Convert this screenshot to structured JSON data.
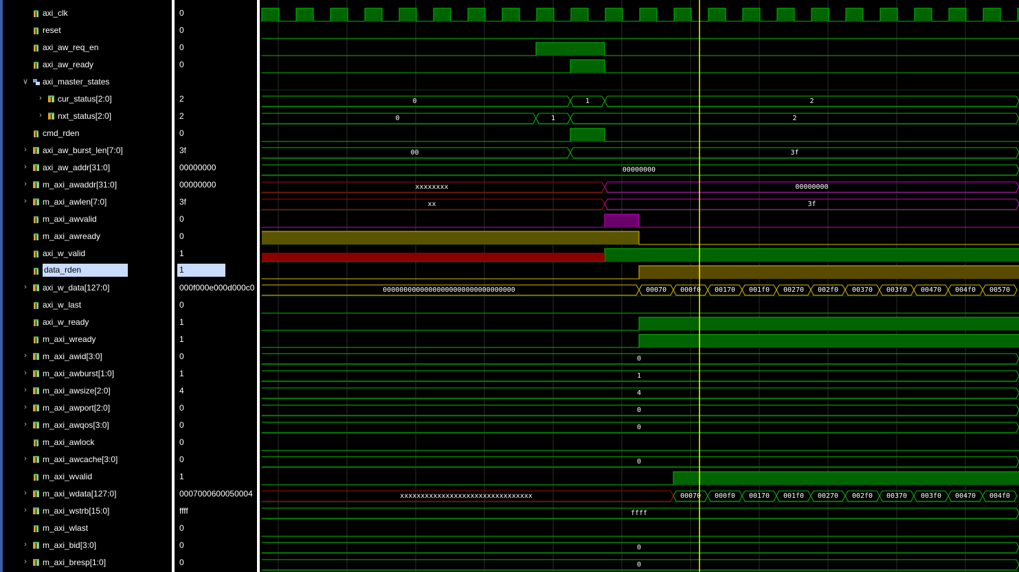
{
  "colors": {
    "background": "#000000",
    "grid": "#2c2c2c",
    "signal_line": "#00c000",
    "signal_fill": "#006400",
    "selected_row": "#c9dcff",
    "cursor": "#ffff00",
    "undefined": "#c00000",
    "purple": "#d000d0",
    "yellow_bus": "#d8c000"
  },
  "cursor": {
    "label": "time cursor"
  },
  "signals": [
    {
      "name": "axi_clk",
      "value": "0",
      "kind": "clock",
      "icon": "bit-signal-icon",
      "expand": false
    },
    {
      "name": "reset",
      "value": "0",
      "kind": "bit",
      "icon": "bit-signal-icon",
      "expand": false
    },
    {
      "name": "axi_aw_req_en",
      "value": "0",
      "kind": "bit",
      "icon": "bit-signal-icon",
      "expand": false
    },
    {
      "name": "axi_aw_ready",
      "value": "0",
      "kind": "bit",
      "icon": "bit-signal-icon",
      "expand": false
    },
    {
      "name": "axi_master_states",
      "value": "",
      "kind": "group",
      "icon": "group-icon",
      "expand": "open"
    },
    {
      "name": "cur_status[2:0]",
      "value": "2",
      "kind": "bus",
      "icon": "bus-signal-icon",
      "expand": "closed",
      "indent": 1
    },
    {
      "name": "nxt_status[2:0]",
      "value": "2",
      "kind": "bus",
      "icon": "bus-signal-icon",
      "expand": "closed",
      "indent": 1
    },
    {
      "name": "cmd_rden",
      "value": "0",
      "kind": "bit",
      "icon": "bit-signal-icon",
      "expand": false
    },
    {
      "name": "axi_aw_burst_len[7:0]",
      "value": "3f",
      "kind": "bus",
      "icon": "bus-signal-icon",
      "expand": "closed"
    },
    {
      "name": "axi_aw_addr[31:0]",
      "value": "00000000",
      "kind": "bus",
      "icon": "bus-signal-icon",
      "expand": "closed"
    },
    {
      "name": "m_axi_awaddr[31:0]",
      "value": "00000000",
      "kind": "bus",
      "icon": "bus-signal-icon",
      "expand": "closed"
    },
    {
      "name": "m_axi_awlen[7:0]",
      "value": "3f",
      "kind": "bus",
      "icon": "bus-signal-icon",
      "expand": "closed"
    },
    {
      "name": "m_axi_awvalid",
      "value": "0",
      "kind": "bit",
      "icon": "bit-signal-icon",
      "expand": false
    },
    {
      "name": "m_axi_awready",
      "value": "0",
      "kind": "bit",
      "icon": "bit-signal-icon",
      "expand": false
    },
    {
      "name": "axi_w_valid",
      "value": "1",
      "kind": "bit",
      "icon": "bit-signal-icon",
      "expand": false
    },
    {
      "name": "data_rden",
      "value": "1",
      "kind": "bit",
      "icon": "bit-signal-icon",
      "expand": false,
      "selected": true
    },
    {
      "name": "axi_w_data[127:0]",
      "value": "000f000e000d000c0",
      "kind": "bus",
      "icon": "bus-signal-icon",
      "expand": "closed"
    },
    {
      "name": "axi_w_last",
      "value": "0",
      "kind": "bit",
      "icon": "bit-signal-icon",
      "expand": false
    },
    {
      "name": "axi_w_ready",
      "value": "1",
      "kind": "bit",
      "icon": "bit-signal-icon",
      "expand": false
    },
    {
      "name": "m_axi_wready",
      "value": "1",
      "kind": "bit",
      "icon": "bit-signal-icon",
      "expand": false
    },
    {
      "name": "m_axi_awid[3:0]",
      "value": "0",
      "kind": "bus",
      "icon": "bus-signal-icon",
      "expand": "closed"
    },
    {
      "name": "m_axi_awburst[1:0]",
      "value": "1",
      "kind": "bus",
      "icon": "bus-signal-icon",
      "expand": "closed"
    },
    {
      "name": "m_axi_awsize[2:0]",
      "value": "4",
      "kind": "bus",
      "icon": "bus-signal-icon",
      "expand": "closed"
    },
    {
      "name": "m_axi_awport[2:0]",
      "value": "0",
      "kind": "bus",
      "icon": "bus-signal-icon",
      "expand": "closed"
    },
    {
      "name": "m_axi_awqos[3:0]",
      "value": "0",
      "kind": "bus",
      "icon": "bus-signal-icon",
      "expand": "closed"
    },
    {
      "name": "m_axi_awlock",
      "value": "0",
      "kind": "bit",
      "icon": "bit-signal-icon",
      "expand": false
    },
    {
      "name": "m_axi_awcache[3:0]",
      "value": "0",
      "kind": "bus",
      "icon": "bus-signal-icon",
      "expand": "closed"
    },
    {
      "name": "m_axi_wvalid",
      "value": "1",
      "kind": "bit",
      "icon": "bit-signal-icon",
      "expand": false
    },
    {
      "name": "m_axi_wdata[127:0]",
      "value": "0007000600050004",
      "kind": "bus",
      "icon": "bus-signal-icon",
      "expand": "closed"
    },
    {
      "name": "m_axi_wstrb[15:0]",
      "value": "ffff",
      "kind": "bus",
      "icon": "bus-signal-icon",
      "expand": "closed"
    },
    {
      "name": "m_axi_wlast",
      "value": "0",
      "kind": "bit",
      "icon": "bit-signal-icon",
      "expand": false
    },
    {
      "name": "m_axi_bid[3:0]",
      "value": "0",
      "kind": "bus",
      "icon": "bus-signal-icon",
      "expand": "closed"
    },
    {
      "name": "m_axi_bresp[1:0]",
      "value": "0",
      "kind": "bus",
      "icon": "bus-signal-icon",
      "expand": "closed"
    }
  ],
  "waves": {
    "cur_status": [
      "0",
      "1",
      "2"
    ],
    "nxt_status": [
      "0",
      "1",
      "2"
    ],
    "axi_aw_burst_len": [
      "00",
      "3f"
    ],
    "axi_aw_addr": [
      "00000000"
    ],
    "m_axi_awaddr": [
      "xxxxxxxx",
      "00000000"
    ],
    "m_axi_awlen": [
      "xx",
      "3f"
    ],
    "axi_w_data": [
      "00000000000000000000000000000000",
      "00070",
      "000f0",
      "00170",
      "001f0",
      "00270",
      "002f0",
      "00370",
      "003f0",
      "00470",
      "004f0",
      "00570"
    ],
    "m_axi_awid": [
      "0"
    ],
    "m_axi_awburst": [
      "1"
    ],
    "m_axi_awsize": [
      "4"
    ],
    "m_axi_awport": [
      "0"
    ],
    "m_axi_awqos": [
      "0"
    ],
    "m_axi_awcache": [
      "0"
    ],
    "m_axi_wdata": [
      "xxxxxxxxxxxxxxxxxxxxxxxxxxxxxxxx",
      "00070",
      "000f0",
      "00170",
      "001f0",
      "00270",
      "002f0",
      "00370",
      "003f0",
      "00470",
      "004f0"
    ],
    "m_axi_wstrb": [
      "ffff"
    ],
    "m_axi_bid": [
      "0"
    ],
    "m_axi_bresp": [
      "0"
    ]
  }
}
